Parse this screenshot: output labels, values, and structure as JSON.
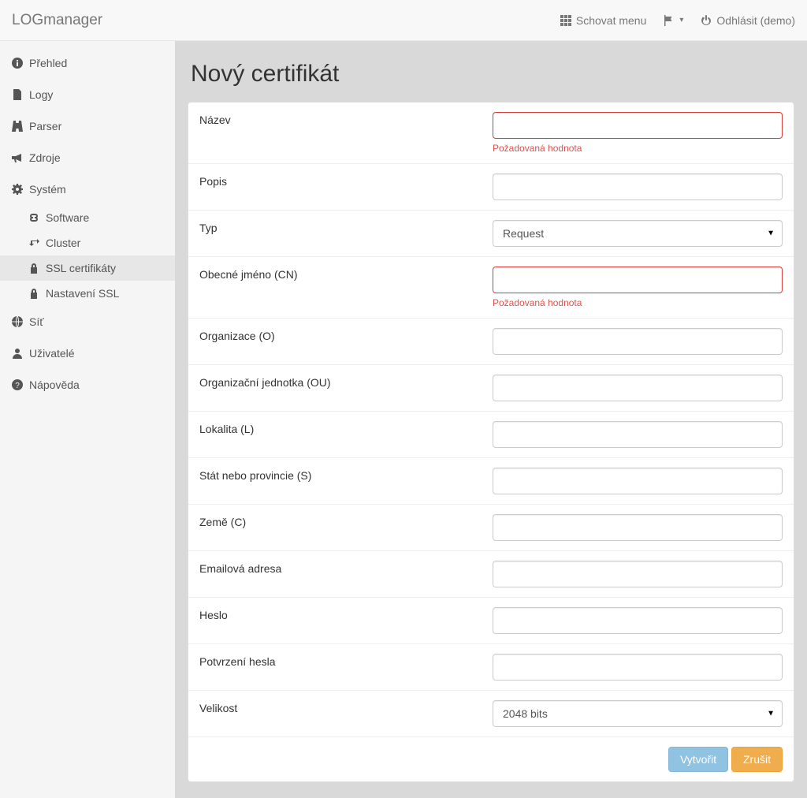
{
  "app": {
    "brand": "LOGmanager"
  },
  "topnav": {
    "hide_menu": "Schovat menu",
    "logout": "Odhlásit (demo)"
  },
  "sidebar": {
    "overview": "Přehled",
    "logs": "Logy",
    "parser": "Parser",
    "sources": "Zdroje",
    "system": "Systém",
    "software": "Software",
    "cluster": "Cluster",
    "ssl_certs": "SSL certifikáty",
    "ssl_settings": "Nastavení SSL",
    "network": "Síť",
    "users": "Uživatelé",
    "help": "Nápověda"
  },
  "page": {
    "title": "Nový certifikát"
  },
  "form": {
    "name": {
      "label": "Název",
      "error": "Požadovaná hodnota",
      "value": ""
    },
    "desc": {
      "label": "Popis",
      "value": ""
    },
    "type": {
      "label": "Typ",
      "selected": "Request"
    },
    "cn": {
      "label": "Obecné jméno (CN)",
      "error": "Požadovaná hodnota",
      "value": ""
    },
    "org": {
      "label": "Organizace (O)",
      "value": ""
    },
    "ou": {
      "label": "Organizační jednotka (OU)",
      "value": ""
    },
    "loc": {
      "label": "Lokalita (L)",
      "value": ""
    },
    "state": {
      "label": "Stát nebo provincie (S)",
      "value": ""
    },
    "country": {
      "label": "Země (C)",
      "value": ""
    },
    "email": {
      "label": "Emailová adresa",
      "value": ""
    },
    "pass": {
      "label": "Heslo",
      "value": ""
    },
    "pass2": {
      "label": "Potvrzení hesla",
      "value": ""
    },
    "size": {
      "label": "Velikost",
      "selected": "2048 bits"
    }
  },
  "buttons": {
    "save": "Vytvořit",
    "cancel": "Zrušit"
  }
}
